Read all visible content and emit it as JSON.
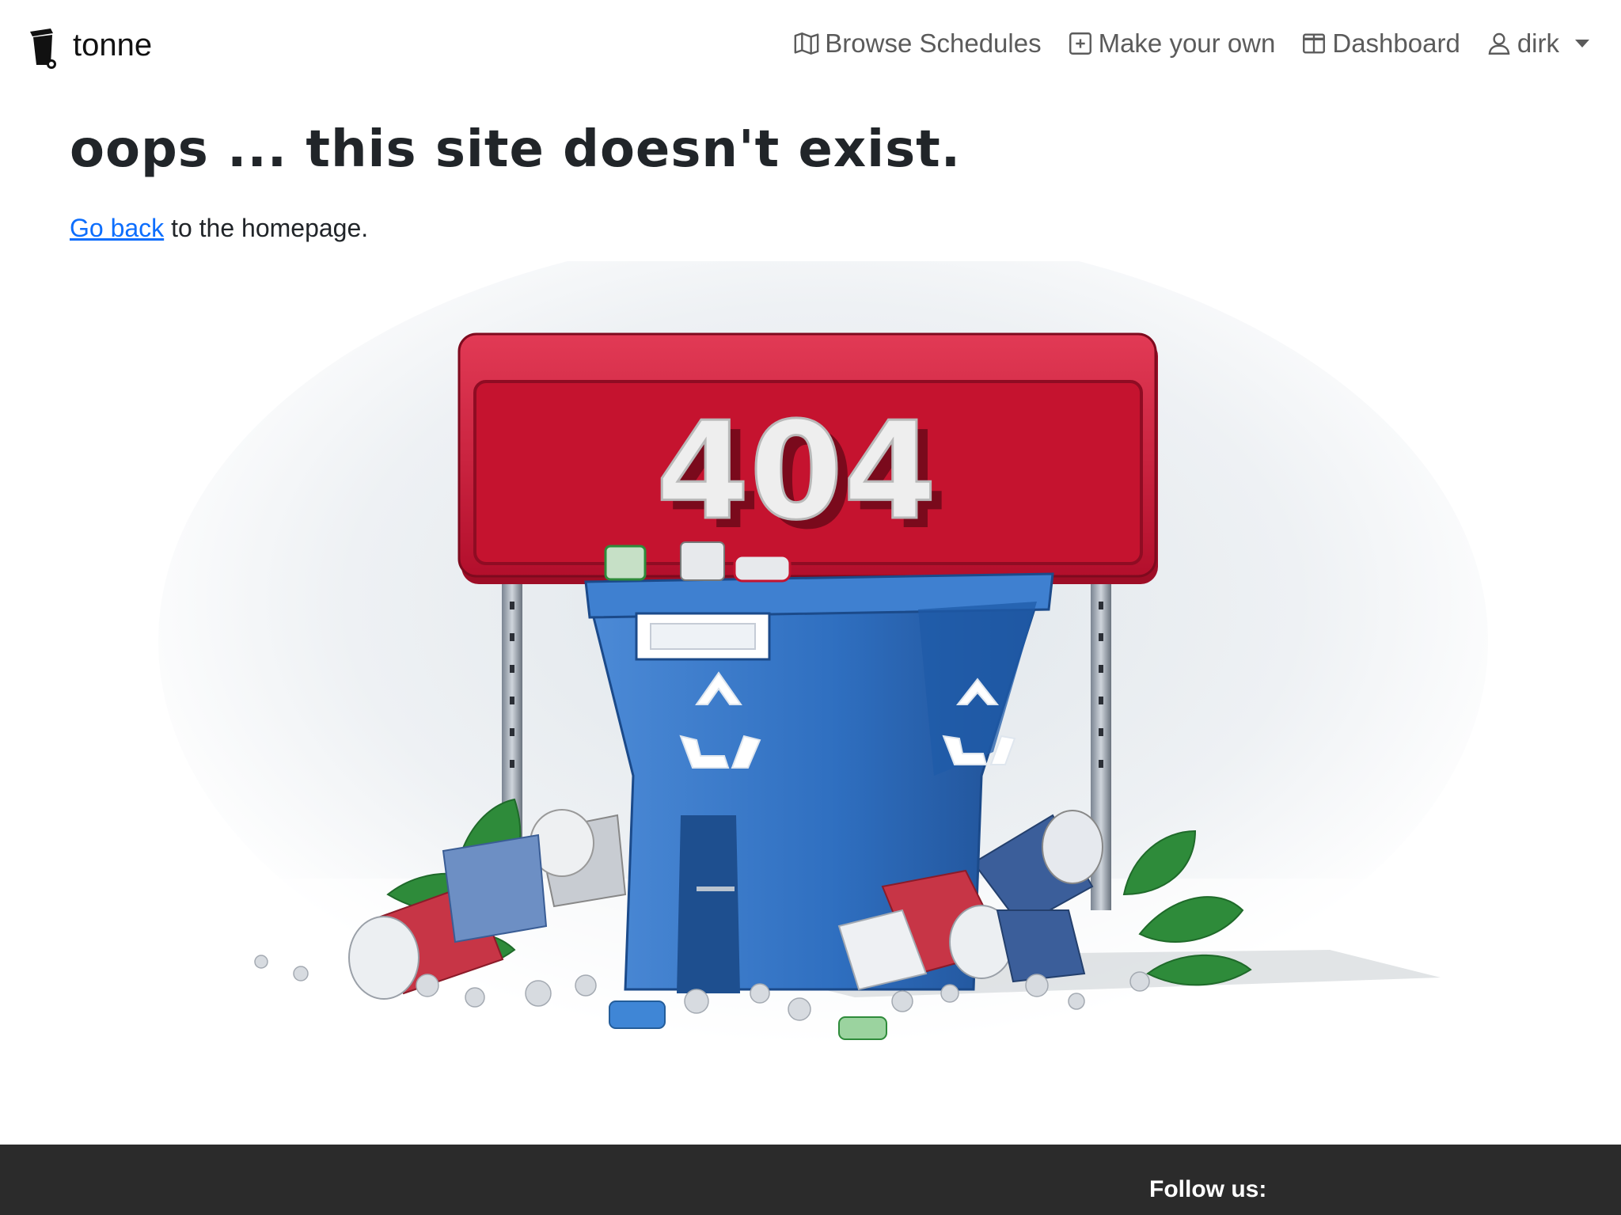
{
  "brand": {
    "name": "tonne",
    "logo_icon": "bin-icon"
  },
  "nav": {
    "items": [
      {
        "label": "Browse Schedules",
        "icon": "map-icon"
      },
      {
        "label": "Make your own",
        "icon": "plus-square-icon"
      },
      {
        "label": "Dashboard",
        "icon": "columns-icon"
      }
    ],
    "user": {
      "label": "dirk",
      "icon": "person-icon"
    }
  },
  "main": {
    "headline": "oops ... this site doesn't exist.",
    "link_text": "Go back",
    "rest_text": " to the homepage.",
    "sign_text": "404"
  },
  "footer": {
    "follow_label": "Follow us:"
  },
  "colors": {
    "link": "#0d6efd",
    "nav_text": "#5b5b5b",
    "footer_bg": "#2b2b2b",
    "sign_red": "#c4122f",
    "bin_blue": "#2f6fc0"
  }
}
